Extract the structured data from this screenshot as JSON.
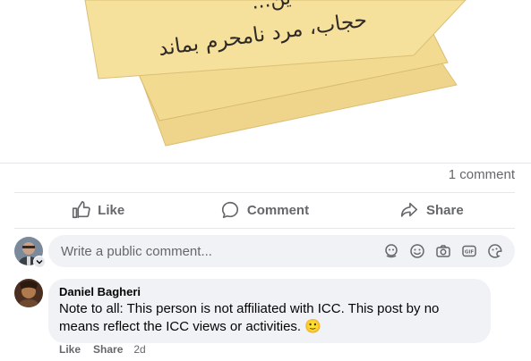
{
  "post": {
    "image_text_line1": "...ین",
    "image_text_line2": "حجاب، مرد نامحرم بماند"
  },
  "stats": {
    "comment_count": "1 comment"
  },
  "actions": {
    "like": "Like",
    "comment": "Comment",
    "share": "Share"
  },
  "composer": {
    "placeholder": "Write a public comment...",
    "tools": [
      "avatar-sticker-icon",
      "emoji-icon",
      "camera-icon",
      "gif-icon",
      "sticker-icon"
    ]
  },
  "comments": [
    {
      "author": "Daniel Bagheri",
      "text": "Note to all: This person is not affiliated with ICC. This post by no means reflect the ICC views or activities. 🙂",
      "like": "Like",
      "share": "Share",
      "time": "2d"
    }
  ],
  "colors": {
    "secondary_text": "#65676b",
    "bubble": "#f0f2f5",
    "paper": "#f3dc95",
    "paper_edge": "#dfc278"
  }
}
